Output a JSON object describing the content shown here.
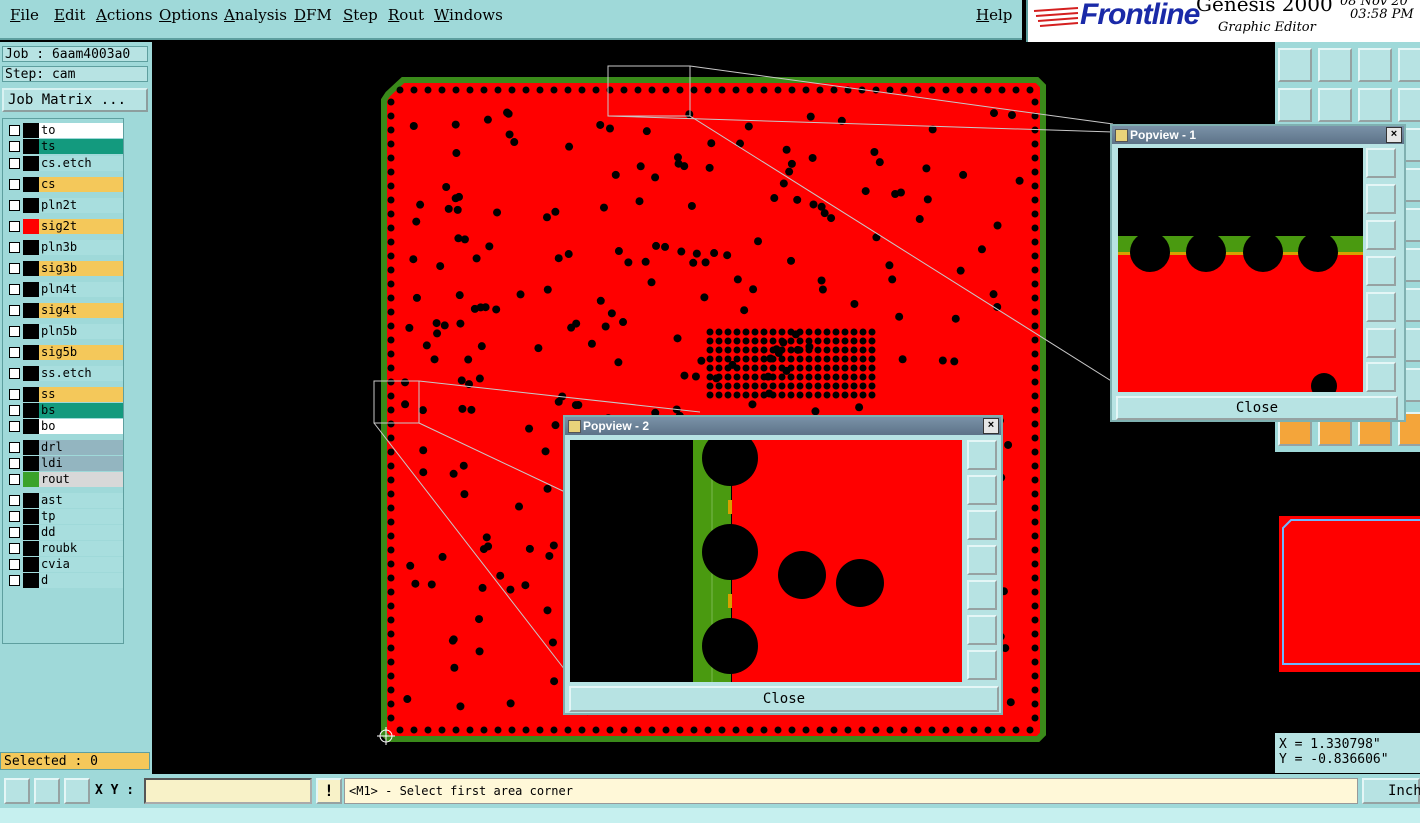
{
  "menu": {
    "items": [
      "File",
      "Edit",
      "Actions",
      "Options",
      "Analysis",
      "DFM",
      "Step",
      "Rout",
      "Windows"
    ],
    "help": "Help"
  },
  "brand": {
    "logo": "Frontline",
    "product": "Genesis 2000",
    "subtitle": "Graphic Editor",
    "date": "08 Nov 20",
    "time": "03:58 PM"
  },
  "job": {
    "job_line": "Job : 6aam4003a0",
    "step_line": "Step: cam",
    "matrix_button": "Job Matrix ..."
  },
  "layers": [
    {
      "name": "to",
      "color": "#ffffff",
      "swatch": "#000000",
      "mark": "✎"
    },
    {
      "name": "ts",
      "color": "#139a7e",
      "swatch": "#000000",
      "mark": ""
    },
    {
      "name": "cs.etch",
      "color": "#a8dede",
      "swatch": "#000000",
      "mark": ""
    },
    {
      "name": "cs",
      "color": "#f4c85a",
      "swatch": "#000000",
      "mark": ""
    },
    {
      "name": "pln2t",
      "color": "#a8dede",
      "swatch": "#000000",
      "mark": ""
    },
    {
      "name": "sig2t",
      "color": "#f4c85a",
      "swatch": "#ff0000",
      "mark": ""
    },
    {
      "name": "pln3b",
      "color": "#a8dede",
      "swatch": "#000000",
      "mark": ""
    },
    {
      "name": "sig3b",
      "color": "#f4c85a",
      "swatch": "#000000",
      "mark": ""
    },
    {
      "name": "pln4t",
      "color": "#a8dede",
      "swatch": "#000000",
      "mark": ""
    },
    {
      "name": "sig4t",
      "color": "#f4c85a",
      "swatch": "#000000",
      "mark": ""
    },
    {
      "name": "pln5b",
      "color": "#a8dede",
      "swatch": "#000000",
      "mark": ""
    },
    {
      "name": "sig5b",
      "color": "#f4c85a",
      "swatch": "#000000",
      "mark": ""
    },
    {
      "name": "ss.etch",
      "color": "#a8dede",
      "swatch": "#000000",
      "mark": ""
    },
    {
      "name": "ss",
      "color": "#f4c85a",
      "swatch": "#000000",
      "mark": ""
    },
    {
      "name": "bs",
      "color": "#139a7e",
      "swatch": "#000000",
      "mark": ""
    },
    {
      "name": "bo",
      "color": "#ffffff",
      "swatch": "#000000",
      "mark": ""
    },
    {
      "name": "drl",
      "color": "#93b5c0",
      "swatch": "#000000",
      "mark": ""
    },
    {
      "name": "ldi",
      "color": "#93b5c0",
      "swatch": "#000000",
      "mark": ""
    },
    {
      "name": "rout",
      "color": "#d8d8d8",
      "swatch": "#3aa22a",
      "mark": "⊞"
    },
    {
      "name": "ast",
      "color": "#a8dede",
      "swatch": "#000000",
      "mark": "✎"
    },
    {
      "name": "tp",
      "color": "#a8dede",
      "swatch": "#000000",
      "mark": ""
    },
    {
      "name": "dd",
      "color": "#a8dede",
      "swatch": "#000000",
      "mark": "✎"
    },
    {
      "name": "roubk",
      "color": "#a8dede",
      "swatch": "#000000",
      "mark": ""
    },
    {
      "name": "cvia",
      "color": "#a8dede",
      "swatch": "#000000",
      "mark": ""
    },
    {
      "name": "d",
      "color": "#a8dede",
      "swatch": "#000000",
      "mark": ""
    }
  ],
  "selected": "Selected : 0",
  "popview1": {
    "title": "Popview - 1",
    "close_label": "Close"
  },
  "popview2": {
    "title": "Popview - 2",
    "close_label": "Close"
  },
  "coords": {
    "x": "X = 1.330798\"",
    "y": "Y = -0.836606\""
  },
  "bottom": {
    "xy_label": "X Y :",
    "xy_value": "",
    "prompt": "<M1> - Select first area corner",
    "unit": "Inch"
  },
  "colors": {
    "copper": "#ff0000",
    "outline": "#3a8a1a",
    "panel": "#9fd9d9",
    "button": "#b7e3e3"
  }
}
